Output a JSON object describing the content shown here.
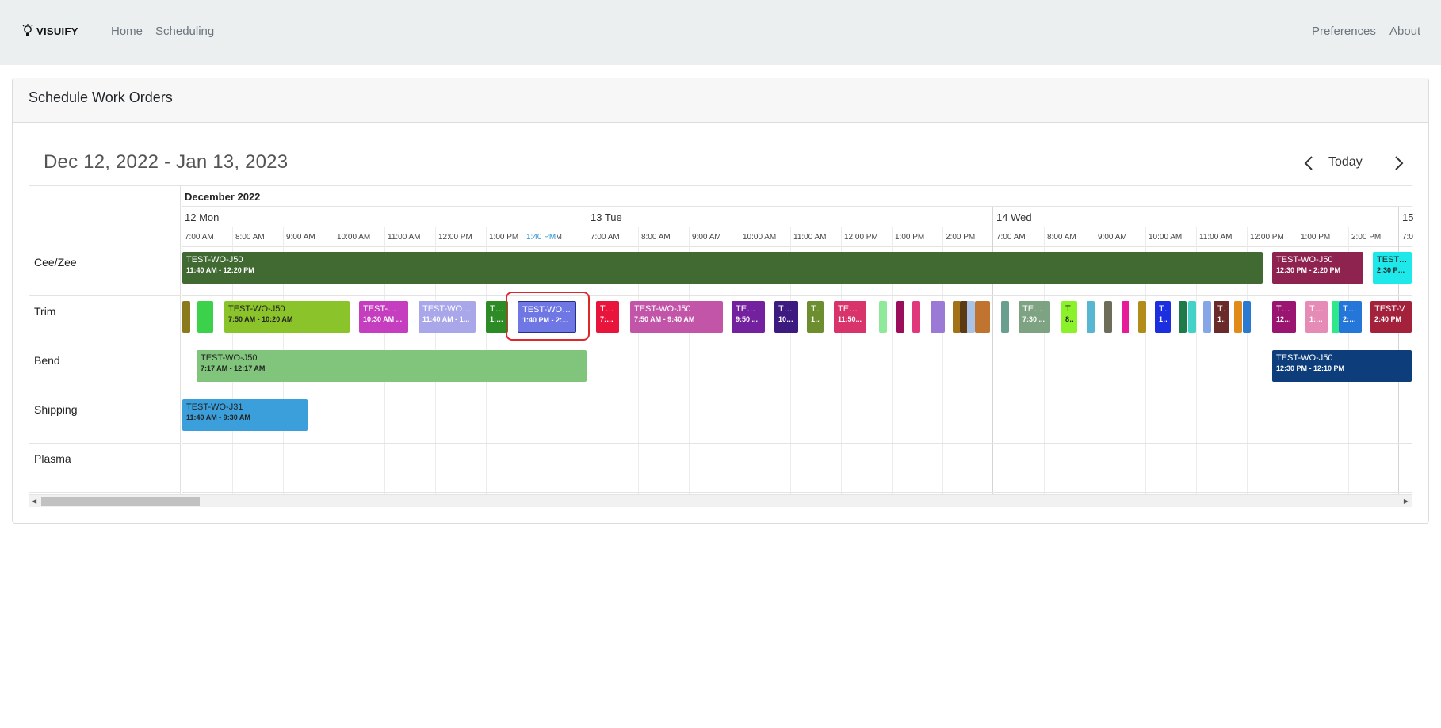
{
  "nav": {
    "brand": "VISUIFY",
    "links": [
      "Home",
      "Scheduling"
    ],
    "right_links": [
      "Preferences",
      "About"
    ]
  },
  "card": {
    "title": "Schedule Work Orders"
  },
  "toolbar": {
    "range": "Dec 12, 2022 - Jan 13, 2023",
    "today": "Today"
  },
  "timeline": {
    "month": "December 2022",
    "days": [
      "12 Mon",
      "13 Tue",
      "14 Wed",
      "15"
    ],
    "hours_day1": [
      "7:00 AM",
      "8:00 AM",
      "9:00 AM",
      "10:00 AM",
      "11:00 AM",
      "12:00 PM",
      "1:00 PM",
      "PM"
    ],
    "hours_day2": [
      "7:00 AM",
      "8:00 AM",
      "9:00 AM",
      "10:00 AM",
      "11:00 AM",
      "12:00 PM",
      "1:00 PM",
      "2:00 PM"
    ],
    "hours_day3": [
      "7:00 AM",
      "8:00 AM",
      "9:00 AM",
      "10:00 AM",
      "11:00 AM",
      "12:00 PM",
      "1:00 PM",
      "2:00 PM"
    ],
    "hours_day4": [
      "7:0"
    ],
    "now_marker": "1:40 PM"
  },
  "resources": [
    "Cee/Zee",
    "Trim",
    "Bend",
    "Shipping",
    "Plasma"
  ],
  "events": {
    "ceezee": [
      {
        "title": "TEST-WO-J50",
        "time": "11:40 AM - 12:20 PM",
        "color": "#416a33"
      },
      {
        "title": "TEST-WO-J50",
        "time": "12:30 PM - 2:20 PM",
        "color": "#8e2350"
      },
      {
        "title": "TEST-WO",
        "time": "2:30 PM -",
        "color": "#1ee8ea"
      }
    ],
    "trim": [
      {
        "title": "TEST-WO-J50",
        "time": "7:50 AM - 10:20 AM",
        "color": "#8bc32b"
      },
      {
        "title": "TEST-WO-",
        "time": "10:30 AM ...",
        "color": "#c53ec0"
      },
      {
        "title": "TEST-WO-J5",
        "time": "11:40 AM - 1...",
        "color": "#a9a6ea"
      },
      {
        "title": "TEST",
        "time": "1:0...",
        "color": "#2c8b25"
      },
      {
        "title": "TEST-WO-J5",
        "time": "1:40 PM - 2:...",
        "color": "#6f77e4"
      },
      {
        "title": "TEST",
        "time": "7:1...",
        "color": "#e8143b"
      },
      {
        "title": "TEST-WO-J50",
        "time": "7:50 AM - 9:40 AM",
        "color": "#c355a8"
      },
      {
        "title": "TEST-V",
        "time": "9:50 ...",
        "color": "#7421a0"
      },
      {
        "title": "TEST",
        "time": "10:...",
        "color": "#3d1a80"
      },
      {
        "title": "TE",
        "time": "1...",
        "color": "#6c8e2f"
      },
      {
        "title": "TEST-(",
        "time": "11:50...",
        "color": "#d8346b"
      },
      {
        "title": "TEST-(",
        "time": "7:30 ...",
        "color": "#7ea383"
      },
      {
        "title": "TE",
        "time": "8...",
        "color": "#8bf12b"
      },
      {
        "title": "TE",
        "time": "1...",
        "color": "#1b2fe0"
      },
      {
        "title": "TE",
        "time": "1...",
        "color": "#6a2a2a"
      },
      {
        "title": "TEST",
        "time": "12:...",
        "color": "#9a1570"
      },
      {
        "title": "TEST",
        "time": "1:1...",
        "color": "#e58bb6"
      },
      {
        "title": "TEST",
        "time": "2:0...",
        "color": "#2476d9"
      },
      {
        "title": "TEST-V",
        "time": "2:40 PM",
        "color": "#a3213b"
      }
    ],
    "bend": [
      {
        "title": "TEST-WO-J50",
        "time": "7:17 AM - 12:17 AM",
        "color": "#81c47c"
      },
      {
        "title": "TEST-WO-J50",
        "time": "12:30 PM - 12:10 PM",
        "color": "#0d3d7b"
      }
    ],
    "shipping": [
      {
        "title": "TEST-WO-J31",
        "time": "11:40 AM - 9:30 AM",
        "color": "#3a9fdb"
      }
    ]
  }
}
